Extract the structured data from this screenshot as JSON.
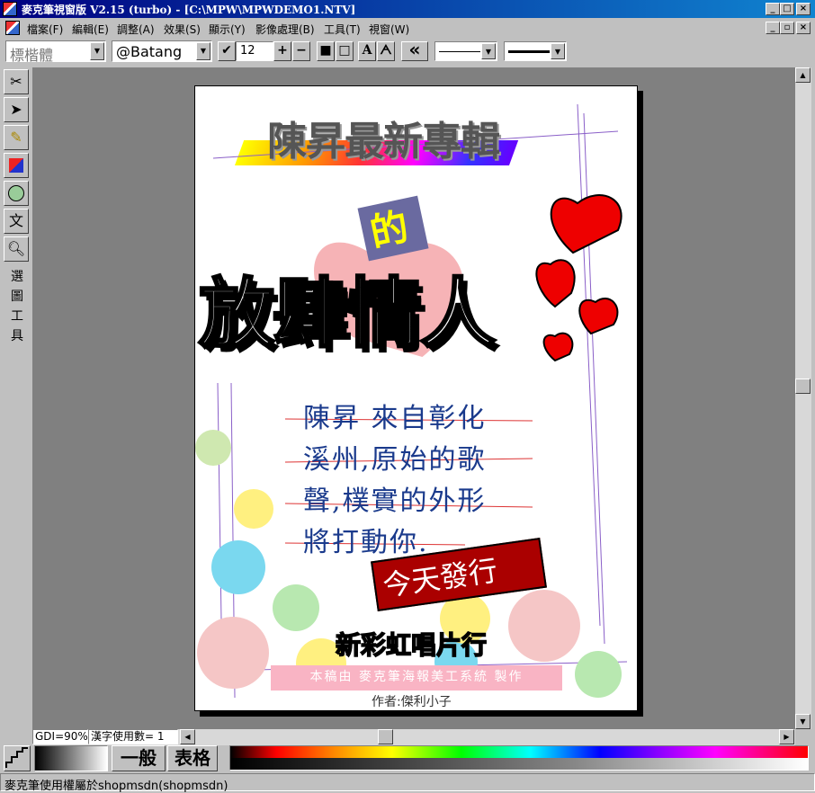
{
  "window": {
    "title": "麥克筆視窗版 V2.15 (turbo) - [C:\\MPW\\MPWDEMO1.NTV]",
    "controls": [
      "_",
      "□",
      "×"
    ]
  },
  "menu": {
    "items": [
      "檔案(F)",
      "編輯(E)",
      "調整(A)",
      "效果(S)",
      "顯示(Y)",
      "影像處理(B)",
      "工具(T)",
      "視窗(W)"
    ]
  },
  "toolbar": {
    "font_chinese": "標楷體",
    "font_latin": "@Batang",
    "font_size": "12",
    "plus": "+",
    "minus": "−",
    "bold_a": "A",
    "double_arrow": "«"
  },
  "left_tools": {
    "vertical_label": [
      "選",
      "圖",
      "工",
      "具"
    ],
    "text_tool": "文"
  },
  "poster": {
    "heading": "陳昇最新專輯",
    "de": "的",
    "big_title": "放肆情人",
    "body_lines": [
      "陳昇 來自彰化",
      "溪州,原始的歌",
      "聲,樸實的外形",
      "將打動你."
    ],
    "release": "今天發行",
    "label": "新彩虹唱片行",
    "credit": "本稿由 麥克筆海報美工系統 製作",
    "author": "作者:傑利小子"
  },
  "info": {
    "gdi": "GDI=90%",
    "chars": "漢字使用數= 1",
    "mode_general": "一般",
    "mode_table": "表格"
  },
  "status": {
    "text": "麥克筆使用權屬於shopmsdn(shopmsdn)"
  },
  "colors": {
    "titlebar": "#000080",
    "accent_red": "#aa0000",
    "body_text": "#1a3a8c"
  }
}
